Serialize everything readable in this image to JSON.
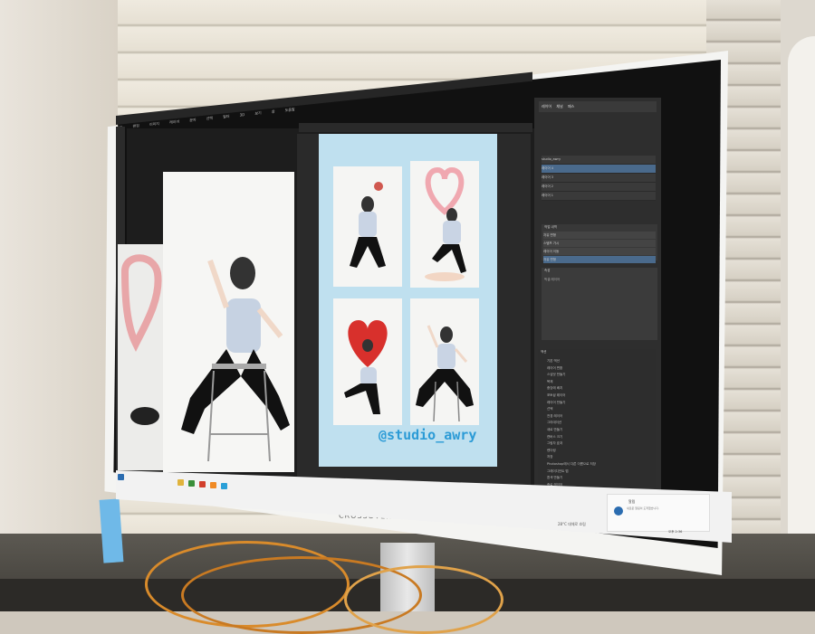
{
  "monitor": {
    "brand": "CROSSOVER"
  },
  "photoshop": {
    "menu": [
      "파일",
      "편집",
      "이미지",
      "레이어",
      "문자",
      "선택",
      "필터",
      "3D",
      "보기",
      "창",
      "도움말"
    ],
    "document_title": "",
    "poster": {
      "handle": "@studio_awry"
    },
    "layers": {
      "tabs": [
        "레이어",
        "채널",
        "패스"
      ],
      "rows": [
        "studio_awry",
        "레이어 4",
        "레이어 3",
        "레이어 2",
        "레이어 1"
      ]
    },
    "history": {
      "title": "작업 내역",
      "rows": [
        "자유 변형",
        "스탬프 가시",
        "레이어 이동",
        "자유 변형"
      ]
    },
    "properties": {
      "title": "속성",
      "rows": [
        "픽셀 레이어"
      ]
    },
    "actions": {
      "title": "액션",
      "rows": [
        "기본 액션",
        "레이어 변환",
        "스냅샷 만들기",
        "복제",
        "중앙에 배치",
        "포토샵 레이어",
        "레이어 만들기",
        "선택",
        "전경 레이어",
        "그라데이션",
        "새로 만들기",
        "캔버스 크기",
        "그림자 효과",
        "렌더링",
        "저장",
        "Photoshop에서 다른 이름으로 저장",
        "그레이디언트 맵",
        "흰색 만들기",
        "종료 레이어",
        "종료"
      ]
    }
  },
  "taskbar": {
    "notification": {
      "title": "알림",
      "text": "새로운 알림이 도착했습니다."
    },
    "weather": "28°C 대체로 흐림",
    "clock": "오후 2:36"
  },
  "colors": {
    "poster_bg": "#bfe0ef",
    "handle_text": "#2c9bd6",
    "selected_layer": "#4a6a8c"
  }
}
